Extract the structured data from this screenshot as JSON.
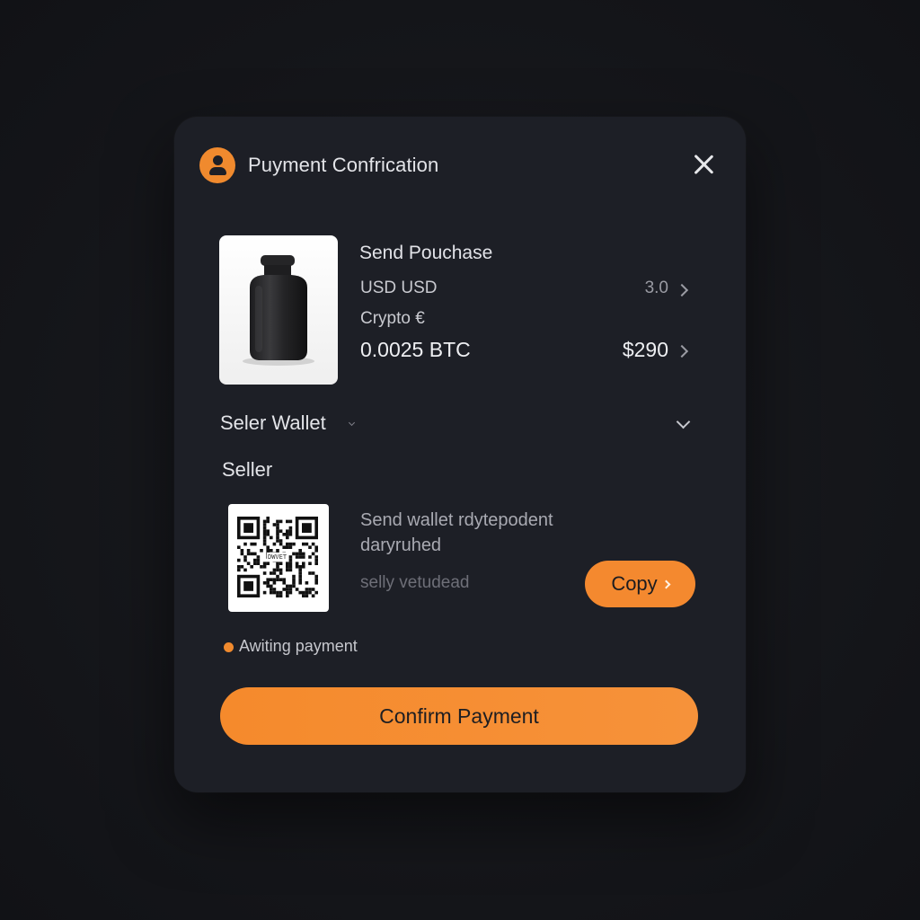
{
  "modal": {
    "title": "Puyment Confrication",
    "close_icon": "close-icon",
    "user_icon": "user-icon"
  },
  "purchase": {
    "title": "Send Pouchase",
    "usd_label": "USD USD",
    "usd_value": "3.0",
    "crypto_label": "Crypto €",
    "btc_amount": "0.0025 BTC",
    "price": "$290",
    "product_image": "black-bottle-image"
  },
  "wallet": {
    "section_label": "Seler Wallet",
    "seller_label": "Seller",
    "qr_caption": "DWVET",
    "address_line1": "Send wallet rdytepodent",
    "address_line2": "daryruhed",
    "address_hint": "selly vetudead",
    "copy_label": "Copy"
  },
  "status": {
    "text": "Awiting payment",
    "color": "#f08a2e"
  },
  "actions": {
    "confirm_label": "Confirm Payment"
  },
  "colors": {
    "accent": "#f08a2e",
    "background": "#15161a",
    "panel": "#1d1f26"
  }
}
